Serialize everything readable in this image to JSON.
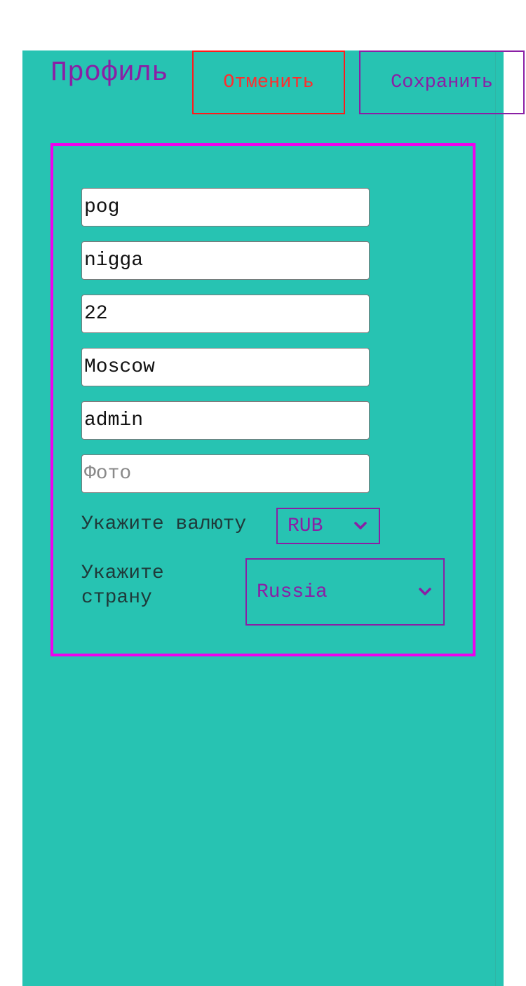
{
  "header": {
    "title": "Профиль",
    "cancel_label": "Отменить",
    "save_label": "Сохранить"
  },
  "form": {
    "fields": [
      {
        "value": "pog",
        "placeholder": ""
      },
      {
        "value": "nigga",
        "placeholder": ""
      },
      {
        "value": "22",
        "placeholder": ""
      },
      {
        "value": "Moscow",
        "placeholder": ""
      },
      {
        "value": "admin",
        "placeholder": ""
      },
      {
        "value": "",
        "placeholder": "Фото"
      }
    ],
    "currency": {
      "label": "Укажите валюту",
      "selected": "RUB"
    },
    "country": {
      "label": "Укажите страну",
      "selected": "Russia"
    }
  },
  "icons": {
    "dropdown": "chevron-down-icon"
  },
  "colors": {
    "background": "#27c3b2",
    "accent": "#8a1fa5",
    "cancel": "#ff1a1a",
    "card_border": "#ee00ee"
  }
}
